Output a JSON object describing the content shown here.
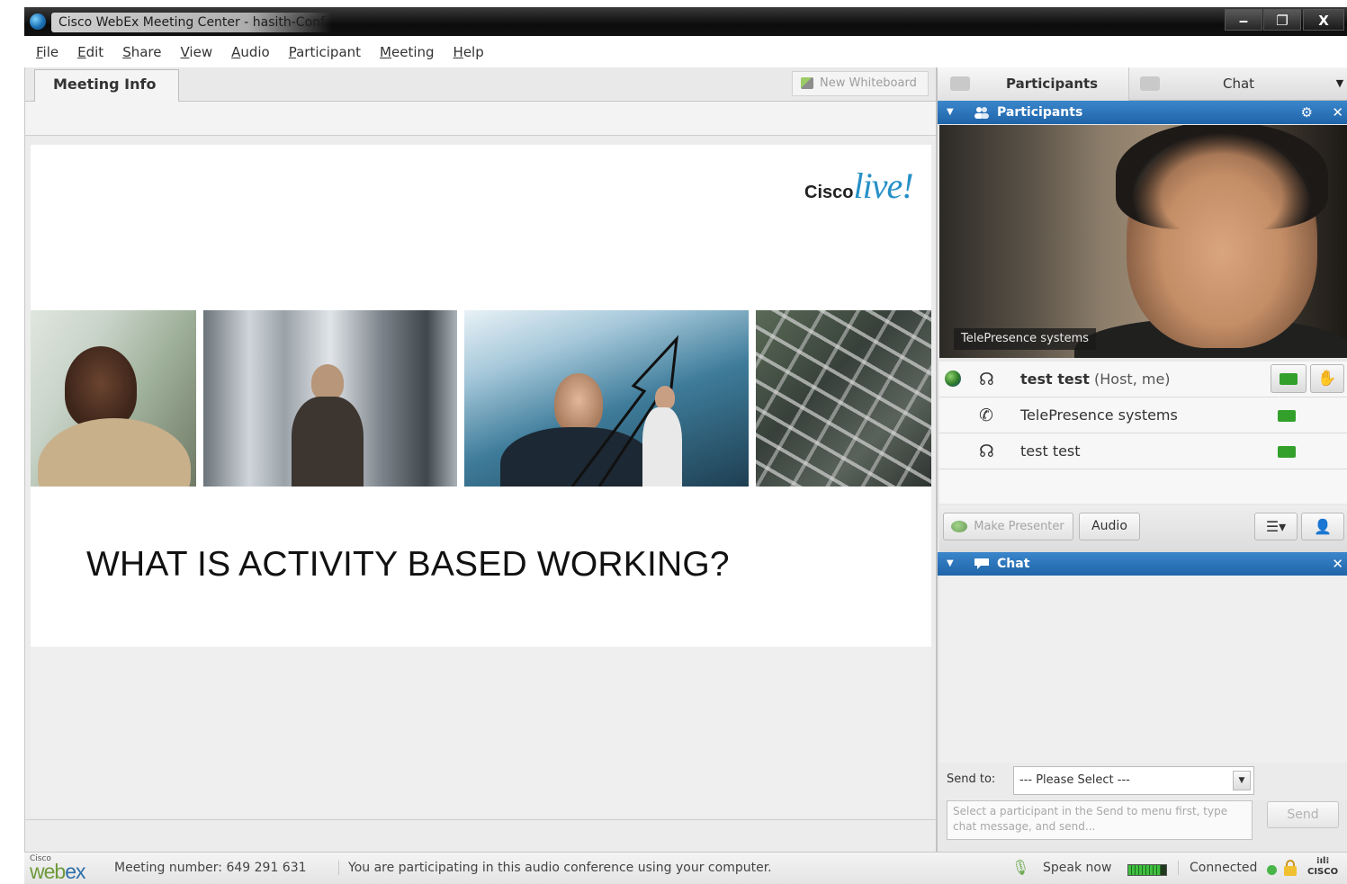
{
  "window": {
    "title": "Cisco WebEx Meeting Center - hasith-Conf",
    "minimize_label": "‒",
    "maximize_label": "❐",
    "close_label": "X"
  },
  "menu": [
    "File",
    "Edit",
    "Share",
    "View",
    "Audio",
    "Participant",
    "Meeting",
    "Help"
  ],
  "left": {
    "tab_meeting_info": "Meeting Info",
    "new_whiteboard": "New Whiteboard"
  },
  "slide": {
    "logo_cisco": "Cisco",
    "logo_live": "live!",
    "heading": "WHAT IS ACTIVITY BASED WORKING?"
  },
  "right": {
    "tabs": {
      "participants": "Participants",
      "chat": "Chat"
    },
    "participants_header": "Participants",
    "video_label": "TelePresence systems",
    "participants": [
      {
        "name": "test test",
        "role": "(Host, me)"
      },
      {
        "name": "TelePresence systems",
        "role": ""
      },
      {
        "name": "test test",
        "role": ""
      }
    ],
    "make_presenter": "Make Presenter",
    "audio": "Audio",
    "chat_header": "Chat",
    "send_to_label": "Send to:",
    "send_to_value": "--- Please Select ---",
    "chat_placeholder": "Select a participant in the Send to menu first, type chat message, and send...",
    "send": "Send"
  },
  "status": {
    "logo_cisco": "Cisco",
    "logo_webex_a": "web",
    "logo_webex_b": "ex",
    "meeting_number": "Meeting number: 649 291 631",
    "audio_status": "You are participating in this audio conference using your computer.",
    "speak_now": "Speak now",
    "speak_level": 0.85,
    "connection": "Connected",
    "cisco_logo": "CISCO"
  },
  "colors": {
    "section_header": "#1f64a8",
    "video_on": "#33a02c",
    "connected": "#49b549"
  }
}
